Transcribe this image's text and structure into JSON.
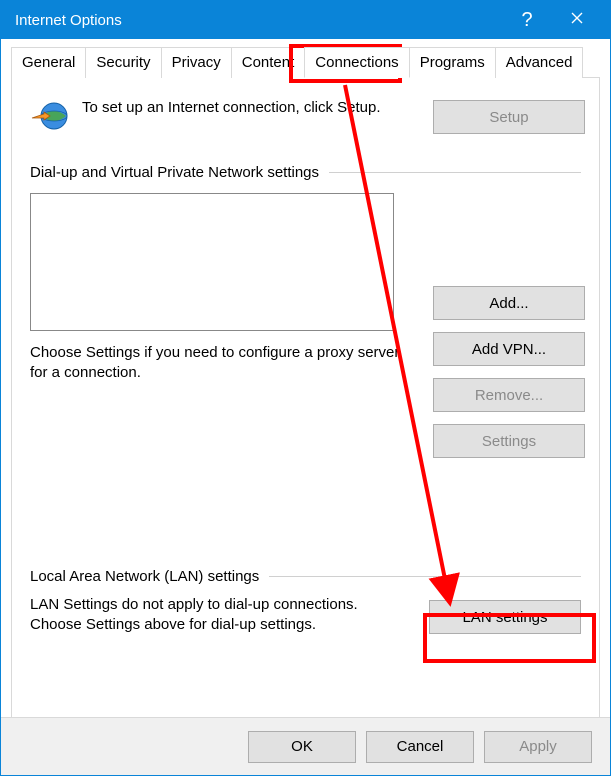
{
  "window": {
    "title": "Internet Options"
  },
  "tabs": {
    "general": "General",
    "security": "Security",
    "privacy": "Privacy",
    "content": "Content",
    "connections": "Connections",
    "programs": "Programs",
    "advanced": "Advanced"
  },
  "intro": {
    "text": "To set up an Internet connection, click Setup.",
    "setup_btn": "Setup"
  },
  "dialup": {
    "title": "Dial-up and Virtual Private Network settings",
    "add_btn": "Add...",
    "add_vpn_btn": "Add VPN...",
    "remove_btn": "Remove...",
    "settings_btn": "Settings",
    "desc": "Choose Settings if you need to configure a proxy server for a connection."
  },
  "lan": {
    "title": "Local Area Network (LAN) settings",
    "desc": "LAN Settings do not apply to dial-up connections. Choose Settings above for dial-up settings.",
    "btn": "LAN settings"
  },
  "footer": {
    "ok": "OK",
    "cancel": "Cancel",
    "apply": "Apply"
  }
}
